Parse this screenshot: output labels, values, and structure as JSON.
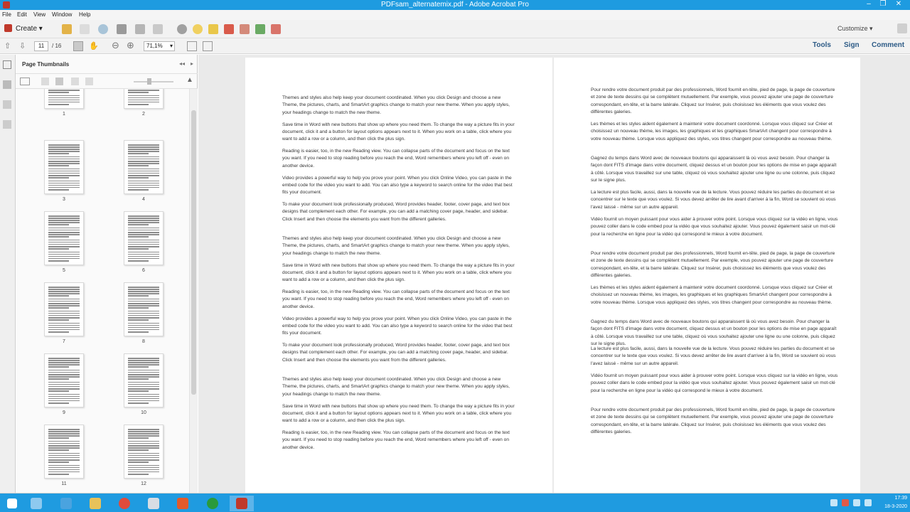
{
  "window": {
    "title": "PDFsam_alternatemix.pdf - Adobe Acrobat Pro"
  },
  "menu": [
    "File",
    "Edit",
    "View",
    "Window",
    "Help"
  ],
  "toolbar": {
    "create_label": "Create",
    "customize_label": "Customize"
  },
  "navigation": {
    "current_page": "11",
    "total_pages": "/ 16",
    "zoom": "71,1%"
  },
  "right_panels": {
    "tools": "Tools",
    "sign": "Sign",
    "comment": "Comment"
  },
  "sidebar": {
    "title": "Page Thumbnails",
    "thumbnails": [
      {
        "label": "1"
      },
      {
        "label": "2"
      },
      {
        "label": "3"
      },
      {
        "label": "4"
      },
      {
        "label": "5"
      },
      {
        "label": "6"
      },
      {
        "label": "7"
      },
      {
        "label": "8"
      },
      {
        "label": "9"
      },
      {
        "label": "10"
      },
      {
        "label": "11"
      },
      {
        "label": "12"
      }
    ]
  },
  "document": {
    "left_page": [
      "Themes and styles also help keep your document coordinated. When you click Design and choose a new Theme, the pictures, charts, and SmartArt graphics change to match your new theme. When you apply styles, your headings change to match the new theme.",
      "Save time in Word with new buttons that show up where you need them. To change the way a picture fits in your document, click it and a button for layout options appears next to it. When you work on a table, click where you want to add a row or a column, and then click the plus sign.",
      "Reading is easier, too, in the new Reading view. You can collapse parts of the document and focus on the text you want. If you need to stop reading before you reach the end, Word remembers where you left off - even on another device.",
      "Video provides a powerful way to help you prove your point. When you click Online Video, you can paste in the embed code for the video you want to add. You can also type a keyword to search online for the video that best fits your document.",
      "To make your document look professionally produced, Word provides header, footer, cover page, and text box designs that complement each other. For example, you can add a matching cover page, header, and sidebar. Click Insert and then choose the elements you want from the different galleries.",
      "Themes and styles also help keep your document coordinated. When you click Design and choose a new Theme, the pictures, charts, and SmartArt graphics change to match your new theme. When you apply styles, your headings change to match the new theme.",
      "Save time in Word with new buttons that show up where you need them. To change the way a picture fits in your document, click it and a button for layout options appears next to it. When you work on a table, click where you want to add a row or a column, and then click the plus sign.",
      "Reading is easier, too, in the new Reading view. You can collapse parts of the document and focus on the text you want. If you need to stop reading before you reach the end, Word remembers where you left off - even on another device.",
      "Video provides a powerful way to help you prove your point. When you click Online Video, you can paste in the embed code for the video you want to add. You can also type a keyword to search online for the video that best fits your document.",
      "To make your document look professionally produced, Word provides header, footer, cover page, and text box designs that complement each other. For example, you can add a matching cover page, header, and sidebar. Click Insert and then choose the elements you want from the different galleries.",
      "Themes and styles also help keep your document coordinated. When you click Design and choose a new Theme, the pictures, charts, and SmartArt graphics change to match your new theme. When you apply styles, your headings change to match the new theme.",
      "Save time in Word with new buttons that show up where you need them. To change the way a picture fits in your document, click it and a button for layout options appears next to it. When you work on a table, click where you want to add a row or a column, and then click the plus sign.",
      "Reading is easier, too, in the new Reading view. You can collapse parts of the document and focus on the text you want. If you need to stop reading before you reach the end, Word remembers where you left off - even on another device."
    ],
    "right_page": [
      "Pour rendre votre document produit par des professionnels, Word fournit en-tête, pied de page, la page de couverture et zone de texte dessins qui se complètent mutuellement. Par exemple, vous pouvez ajouter une page de couverture correspondant, en-tête, et la barre latérale. Cliquez sur Insérer, puis choisissez les éléments que vous voulez des différentes galeries.",
      "Les thèmes et les styles aident également à maintenir votre document coordonné. Lorsque vous cliquez sur Créer et choisissez un nouveau thème, les images, les graphiques et les graphiques SmartArt changent pour correspondre à votre nouveau thème. Lorsque vous appliquez des styles, vos titres changent pour correspondre au nouveau thème.",
      "Gagnez du temps dans Word avec de nouveaux boutons qui apparaissent là où vous avez besoin. Pour changer la façon dont FITS d'image dans votre document, cliquez dessus et un bouton pour les options de mise en page apparaît à côté. Lorsque vous travaillez sur une table, cliquez où vous souhaitez ajouter une ligne ou une colonne, puis cliquez sur le signe plus.",
      "La lecture est plus facile, aussi, dans la nouvelle vue de la lecture. Vous pouvez réduire les parties du document et se concentrer sur le texte que vous voulez. Si vous devez arrêter de lire avant d'arriver à la fin, Word se souvient où vous l'avez laissé - même sur un autre appareil.",
      "Vidéo fournit un moyen puissant pour vous aider à prouver votre point. Lorsque vous cliquez sur la vidéo en ligne, vous pouvez coller dans le code embed pour la vidéo que vous souhaitez ajouter. Vous pouvez également saisir un mot-clé pour la recherche en ligne pour la vidéo qui correspond le mieux à votre document.",
      "Pour rendre votre document produit par des professionnels, Word fournit en-tête, pied de page, la page de couverture et zone de texte dessins qui se complètent mutuellement. Par exemple, vous pouvez ajouter une page de couverture correspondant, en-tête, et la barre latérale. Cliquez sur Insérer, puis choisissez les éléments que vous voulez des différentes galeries.",
      "Les thèmes et les styles aident également à maintenir votre document coordonné. Lorsque vous cliquez sur Créer et choisissez un nouveau thème, les images, les graphiques et les graphiques SmartArt changent pour correspondre à votre nouveau thème. Lorsque vous appliquez des styles, vos titres changent pour correspondre au nouveau thème.",
      "Gagnez du temps dans Word avec de nouveaux boutons qui apparaissent là où vous avez besoin. Pour changer la façon dont FITS d'image dans votre document, cliquez dessus et un bouton pour les options de mise en page apparaît à côté. Lorsque vous travaillez sur une table, cliquez où vous souhaitez ajouter une ligne ou une colonne, puis cliquez sur le signe plus.",
      "La lecture est plus facile, aussi, dans la nouvelle vue de la lecture. Vous pouvez réduire les parties du document et se concentrer sur le texte que vous voulez. Si vous devez arrêter de lire avant d'arriver à la fin, Word se souvient où vous l'avez laissé - même sur un autre appareil.",
      "Vidéo fournit un moyen puissant pour vous aider à prouver votre point. Lorsque vous cliquez sur la vidéo en ligne, vous pouvez coller dans le code embed pour la vidéo que vous souhaitez ajouter. Vous pouvez également saisir un mot-clé pour la recherche en ligne pour la vidéo qui correspond le mieux à votre document.",
      "Pour rendre votre document produit par des professionnels, Word fournit en-tête, pied de page, la page de couverture et zone de texte dessins qui se complètent mutuellement. Par exemple, vous pouvez ajouter une page de couverture correspondant, en-tête, et la barre latérale. Cliquez sur Insérer, puis choisissez les éléments que vous voulez des différentes galeries."
    ]
  },
  "taskbar": {
    "time": "17:39",
    "date": "18-3-2020"
  },
  "colors": {
    "titlebar": "#1e9be0",
    "taskbar": "#1f9be0",
    "link": "#2d5b86"
  }
}
